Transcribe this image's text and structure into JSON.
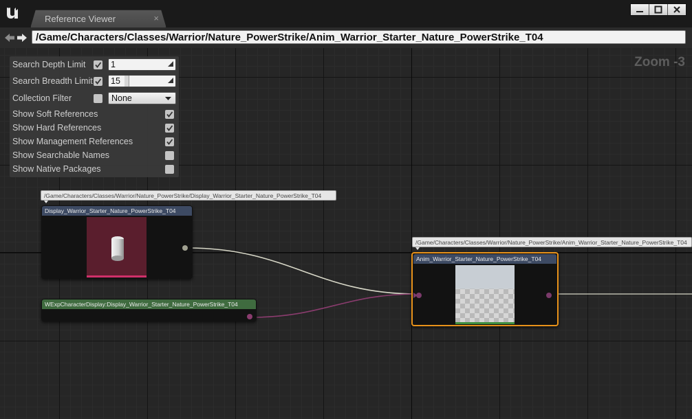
{
  "window": {
    "tab_title": "Reference Viewer",
    "tab_close_glyph": "×"
  },
  "path_bar": {
    "path": "/Game/Characters/Classes/Warrior/Nature_PowerStrike/Anim_Warrior_Starter_Nature_PowerStrike_T04"
  },
  "graph": {
    "zoom_label": "Zoom -3"
  },
  "settings": {
    "search_depth_label": "Search Depth Limit",
    "search_depth_enabled": true,
    "search_depth_value": "1",
    "search_breadth_label": "Search Breadth Limit",
    "search_breadth_enabled": true,
    "search_breadth_value": "15",
    "collection_filter_label": "Collection Filter",
    "collection_filter_enabled": false,
    "collection_filter_value": "None",
    "toggles": [
      {
        "label": "Show Soft References",
        "checked": true
      },
      {
        "label": "Show Hard References",
        "checked": true
      },
      {
        "label": "Show Management References",
        "checked": true
      },
      {
        "label": "Show Searchable Names",
        "checked": false
      },
      {
        "label": "Show Native Packages",
        "checked": false
      }
    ]
  },
  "nodes": {
    "display": {
      "path": "/Game/Characters/Classes/Warrior/Nature_PowerStrike/Display_Warrior_Starter_Nature_PowerStrike_T04",
      "title": "Display_Warrior_Starter_Nature_PowerStrike_T04",
      "header_color": "#3d4a63",
      "thumb_color": "#5a1e2d",
      "thumb_bar_color": "#d0306a"
    },
    "class": {
      "title": "WExpCharacterDisplay:Display_Warrior_Starter_Nature_PowerStrike_T04",
      "header_color": "#3f6b3f",
      "wire_color": "#8a3c6e"
    },
    "anim": {
      "path": "/Game/Characters/Classes/Warrior/Nature_PowerStrike/Anim_Warrior_Starter_Nature_PowerStrike_T04",
      "title": "Anim_Warrior_Starter_Nature_PowerStrike_T04",
      "header_color": "#3d4a63",
      "selection_color": "#e8921a",
      "thumb_bar_color": "#3f8f3f"
    }
  },
  "icons": {
    "logo": "unreal-logo-icon",
    "back": "back-arrow-icon",
    "forward": "forward-arrow-icon",
    "minimize": "minimize-icon",
    "maximize": "maximize-icon",
    "close": "close-icon"
  }
}
